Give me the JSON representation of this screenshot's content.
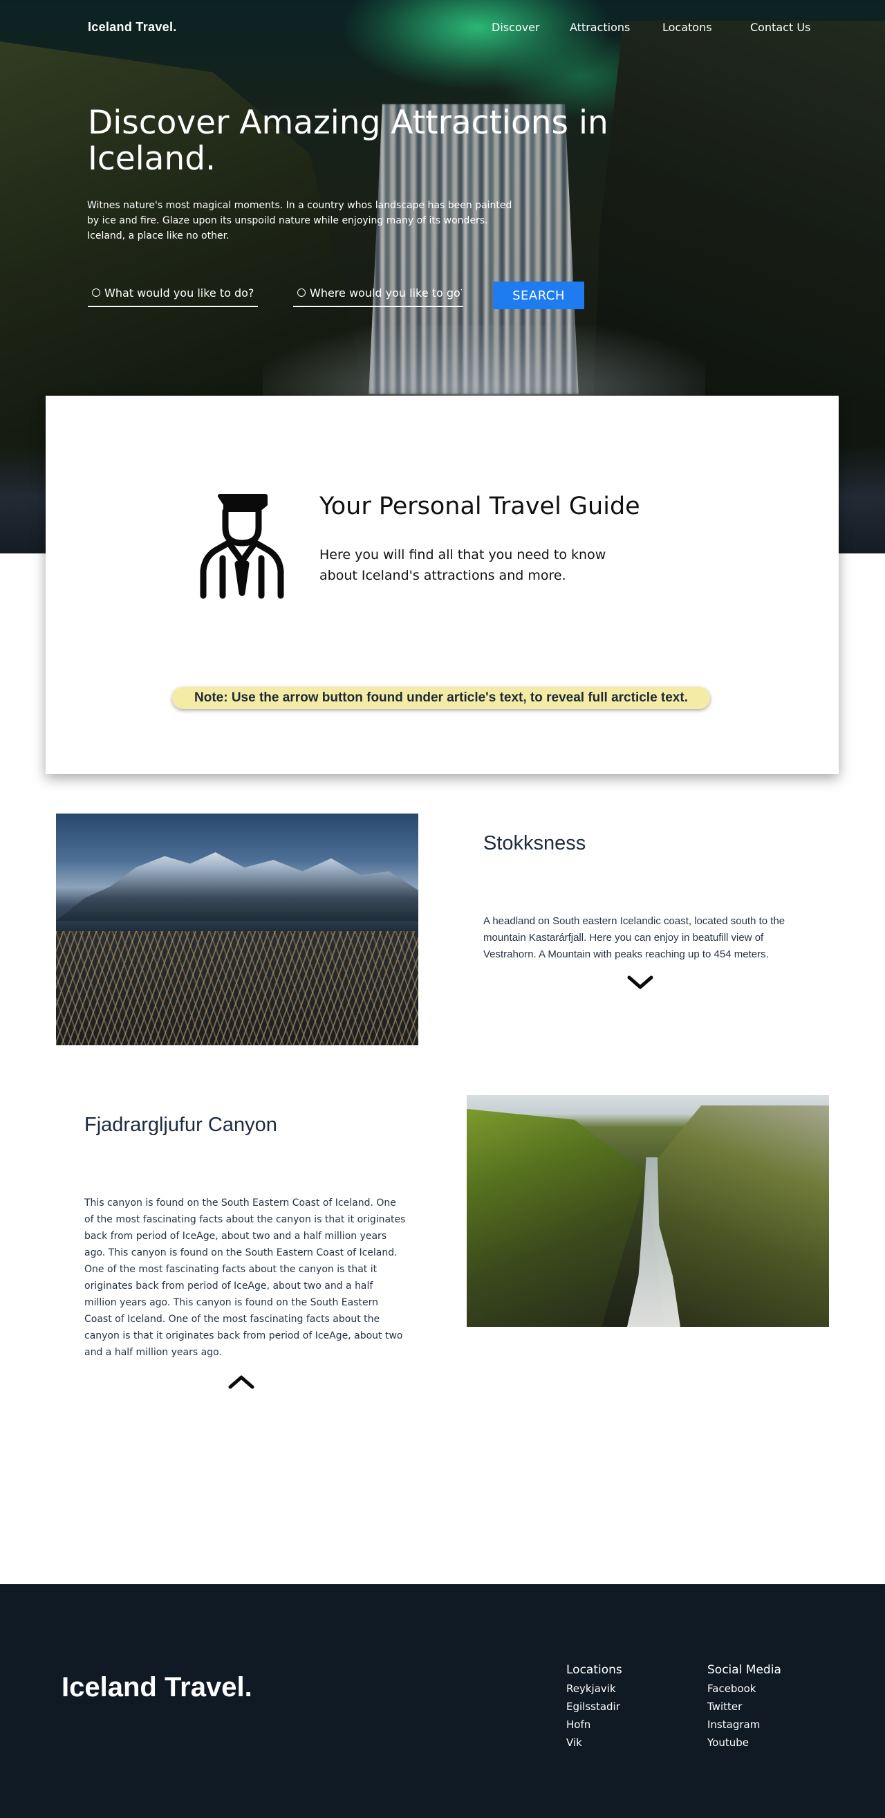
{
  "header": {
    "brand": "Iceland Travel.",
    "nav": [
      "Discover",
      "Attractions",
      "Locatons",
      "Contact Us"
    ]
  },
  "hero": {
    "title": "Discover Amazing Attractions in Iceland.",
    "description_lines": [
      "Witnes nature's most magical  moments. In a country whos landscape has been painted",
      "by ice and fire.  Glaze upon its unspoild nature while enjoying  many of its wonders.",
      "Iceland, a place like no other."
    ],
    "search": {
      "activity_placeholder": "What would you like to do?",
      "location_placeholder": "Where would you like to go?",
      "button_label": "SEARCH"
    }
  },
  "guide": {
    "title": "Your Personal Travel Guide",
    "text": "Here you will find all that you need to know about Iceland's attractions and more.",
    "note": "Note: Use the arrow button found under article's text, to reveal full arcticle text.",
    "icon": "travel-guide-person-icon"
  },
  "articles": [
    {
      "title": "Stokksness",
      "text": "A headland on South eastern Icelandic coast, located south to the mountain Kastarárfjall. Here you can enjoy in beatufill view of Vestrahorn. A Mountain with peaks reaching up to 454 meters.",
      "toggle_icon": "chevron-down-icon"
    },
    {
      "title": "Fjadrargljufur Canyon",
      "text": "This  canyon is found on the South Eastern Coast of Iceland. One of the most fascinating facts about the canyon is that it originates back from period of IceAge, about two and a half million years ago. This  canyon is found on the South Eastern Coast of Iceland. One of the most fascinating facts about the canyon is that it originates back from period of IceAge, about two and a half million years ago. This  canyon is found on the South Eastern Coast of Iceland. One of the most fascinating facts about the canyon is that it originates back from period of IceAge, about two and a half million years ago.",
      "toggle_icon": "chevron-up-icon"
    }
  ],
  "footer": {
    "brand": "Iceland Travel.",
    "locations_heading": "Locations",
    "locations": [
      "Reykjavik",
      "Egilsstadir",
      "Hofn",
      "Vik"
    ],
    "social_heading": "Social Media",
    "social": [
      "Facebook",
      "Twitter",
      "Instagram",
      "Youtube"
    ]
  },
  "colors": {
    "accent": "#1e7cf0",
    "footer_bg": "#101a24",
    "note_bg": "#f4eca6",
    "heading_text": "#1c2b3d"
  }
}
